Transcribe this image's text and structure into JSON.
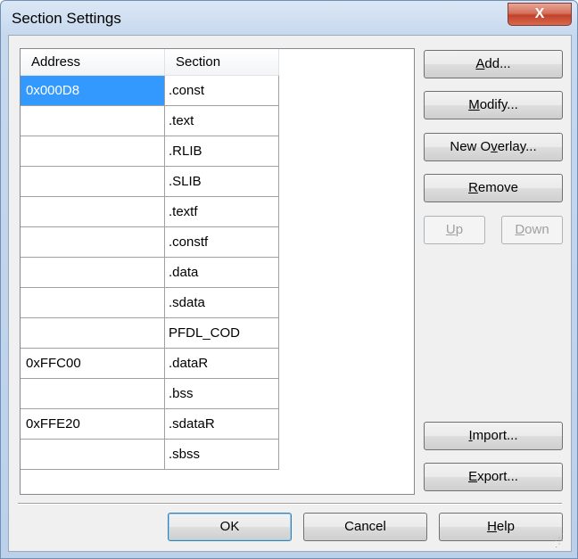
{
  "window": {
    "title": "Section Settings",
    "close_label": "X"
  },
  "table": {
    "headers": {
      "address": "Address",
      "section": "Section"
    },
    "rows": [
      {
        "address": "0x000D8",
        "section": ".const",
        "selected": true
      },
      {
        "address": "",
        "section": ".text"
      },
      {
        "address": "",
        "section": ".RLIB"
      },
      {
        "address": "",
        "section": ".SLIB"
      },
      {
        "address": "",
        "section": ".textf"
      },
      {
        "address": "",
        "section": ".constf"
      },
      {
        "address": "",
        "section": ".data"
      },
      {
        "address": "",
        "section": ".sdata"
      },
      {
        "address": "",
        "section": "PFDL_COD"
      },
      {
        "address": "0xFFC00",
        "section": ".dataR"
      },
      {
        "address": "",
        "section": ".bss"
      },
      {
        "address": "0xFFE20",
        "section": ".sdataR"
      },
      {
        "address": "",
        "section": ".sbss"
      }
    ]
  },
  "buttons": {
    "add": {
      "pre": "",
      "key": "A",
      "post": "dd..."
    },
    "modify": {
      "pre": "",
      "key": "M",
      "post": "odify..."
    },
    "new_overlay": {
      "pre": "New O",
      "key": "v",
      "post": "erlay..."
    },
    "remove": {
      "pre": "",
      "key": "R",
      "post": "emove"
    },
    "up": {
      "pre": "",
      "key": "U",
      "post": "p"
    },
    "down": {
      "pre": "",
      "key": "D",
      "post": "own"
    },
    "import": {
      "pre": "",
      "key": "I",
      "post": "mport..."
    },
    "export": {
      "pre": "",
      "key": "E",
      "post": "xport..."
    },
    "ok": {
      "label": "OK"
    },
    "cancel": {
      "label": "Cancel"
    },
    "help": {
      "pre": "",
      "key": "H",
      "post": "elp"
    }
  }
}
